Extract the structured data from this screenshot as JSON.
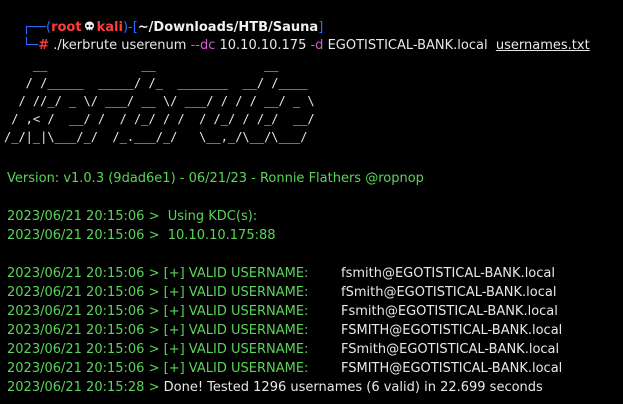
{
  "colors": {
    "background": "#000000",
    "prompt_bracket": "#2a6cff",
    "prompt_user": "#ff3b3b",
    "flag": "#d35bd3",
    "log_green": "#5ad45a",
    "text": "#e8e8e8"
  },
  "prompt": {
    "user": "root",
    "skull_icon": "skull-icon",
    "host": "kali",
    "path": "~/Downloads/HTB/Sauna",
    "hash": "#",
    "cmd_exe": "./kerbrute userenum",
    "flag_dc": "--dc",
    "dc_value": "10.10.10.175",
    "flag_d": "-d",
    "domain_value": "EGOTISTICAL-BANK.local",
    "file": "usernames.txt"
  },
  "banner": {
    "line1": "    __             __               __     ",
    "line2": "   / /_____  _____/ /_  _______  __/ /____ ",
    "line3": "  / //_/ _ \\/ ___/ __ \\/ ___/ / / / __/ _ \\",
    "line4": " / ,< /  __/ /  / /_/ / /  / /_/ / /_/  __/",
    "line5": "/_/|_|\\___/_/  /_.___/_/   \\__,_/\\__/\\___/ "
  },
  "version": "Version: v1.0.3 (9dad6e1) - 06/21/23 - Ronnie Flathers @ropnop",
  "kdc": {
    "l1_ts": "2023/06/21 20:15:06 >",
    "l1_msg": "Using KDC(s):",
    "l2_ts": "2023/06/21 20:15:06 >",
    "l2_msg": "10.10.10.175:88"
  },
  "results": [
    {
      "ts": "2023/06/21 20:15:06 >",
      "label": "[+] VALID USERNAME:",
      "user": "fsmith@EGOTISTICAL-BANK.local"
    },
    {
      "ts": "2023/06/21 20:15:06 >",
      "label": "[+] VALID USERNAME:",
      "user": "fSmith@EGOTISTICAL-BANK.local"
    },
    {
      "ts": "2023/06/21 20:15:06 >",
      "label": "[+] VALID USERNAME:",
      "user": "Fsmith@EGOTISTICAL-BANK.local"
    },
    {
      "ts": "2023/06/21 20:15:06 >",
      "label": "[+] VALID USERNAME:",
      "user": "FSMITH@EGOTISTICAL-BANK.local"
    },
    {
      "ts": "2023/06/21 20:15:06 >",
      "label": "[+] VALID USERNAME:",
      "user": "FSmith@EGOTISTICAL-BANK.local"
    },
    {
      "ts": "2023/06/21 20:15:06 >",
      "label": "[+] VALID USERNAME:",
      "user": "FSMITH@EGOTISTICAL-BANK.local"
    }
  ],
  "done": {
    "ts": "2023/06/21 20:15:28 >",
    "msg": "Done! Tested 1296 usernames (6 valid) in 22.699 seconds"
  }
}
